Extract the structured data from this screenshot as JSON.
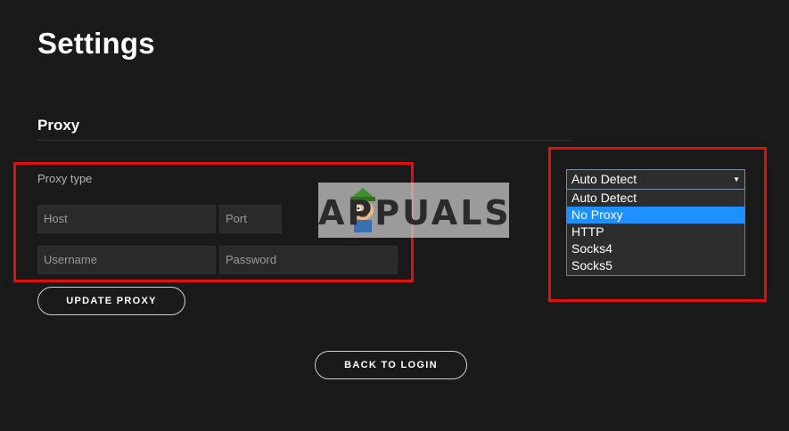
{
  "page": {
    "title": "Settings"
  },
  "proxy": {
    "section_title": "Proxy",
    "type_label": "Proxy type",
    "host_placeholder": "Host",
    "port_placeholder": "Port",
    "username_placeholder": "Username",
    "password_placeholder": "Password",
    "update_button": "UPDATE PROXY"
  },
  "proxy_select": {
    "selected_value": "Auto Detect",
    "options": [
      "Auto Detect",
      "No Proxy",
      "HTTP",
      "Socks4",
      "Socks5"
    ],
    "highlighted_option": "No Proxy"
  },
  "footer": {
    "back_button": "BACK TO LOGIN"
  },
  "watermark": {
    "text": "APPUALS"
  },
  "colors": {
    "background": "#1a1a1a",
    "annotation_red": "#e01010",
    "highlight_blue": "#1e90ff"
  }
}
